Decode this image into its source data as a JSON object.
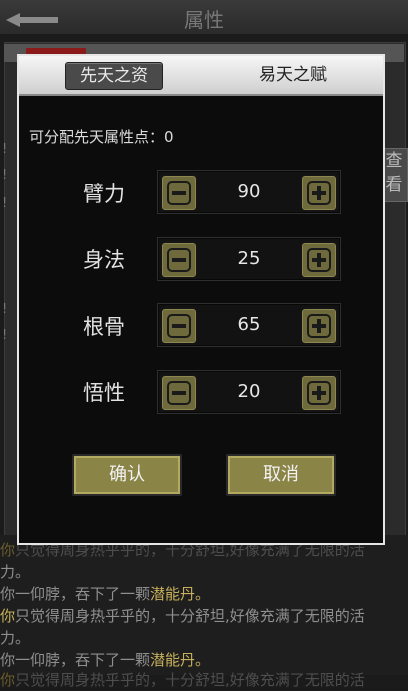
{
  "screen": {
    "title": "属性"
  },
  "side": {
    "label_1": "查",
    "label_2": "看"
  },
  "dialog": {
    "tabs": [
      {
        "label": "先天之资",
        "active": true
      },
      {
        "label": "易天之赋",
        "active": false
      }
    ],
    "points_label": "可分配先天属性点：",
    "points_value": "0",
    "attributes": [
      {
        "label": "臂力",
        "value": "90"
      },
      {
        "label": "身法",
        "value": "25"
      },
      {
        "label": "根骨",
        "value": "65"
      },
      {
        "label": "悟性",
        "value": "20"
      }
    ],
    "confirm_label": "确认",
    "cancel_label": "取消"
  },
  "log": {
    "lines": [
      {
        "pre": "你",
        "text": "只觉得周身热乎乎的，十分舒坦,好像充满了无限的活"
      },
      {
        "pre": "",
        "text": "力。"
      },
      {
        "pre": "你一仰脖，吞下了一颗",
        "text": "潜能丹。"
      },
      {
        "pre": "你",
        "text": "只觉得周身热乎乎的，十分舒坦,好像充满了无限的活"
      },
      {
        "pre": "",
        "text": "力。"
      },
      {
        "pre": "你一仰脖，吞下了一颗",
        "text": "潜能丹。"
      },
      {
        "pre": "你",
        "text": "只觉得周身热乎乎的，十分舒坦,好像充满了无限的活"
      }
    ]
  },
  "colors": {
    "stepper": "#6e6a3c",
    "button": "#8a8447",
    "highlight_text": "#c8b15a"
  }
}
